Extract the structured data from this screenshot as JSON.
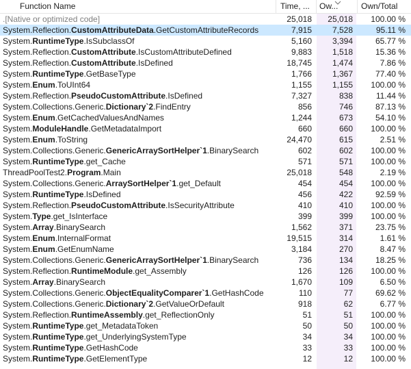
{
  "columns": {
    "name": "Function Name",
    "time": "Time, ...",
    "own": "Ow...",
    "pct": "Own/Total"
  },
  "rows": [
    {
      "parts": [
        {
          "t": ".[Native or optimized code]",
          "b": false
        }
      ],
      "time": "25,018",
      "own": "25,018",
      "pct": "100.00 %",
      "native": true
    },
    {
      "parts": [
        {
          "t": "System.Reflection.",
          "b": false
        },
        {
          "t": "CustomAttributeData",
          "b": true
        },
        {
          "t": ".GetCustomAttributeRecords",
          "b": false
        }
      ],
      "time": "7,915",
      "own": "7,528",
      "pct": "95.11 %",
      "selected": true
    },
    {
      "parts": [
        {
          "t": "System.",
          "b": false
        },
        {
          "t": "RuntimeType",
          "b": true
        },
        {
          "t": ".IsSubclassOf",
          "b": false
        }
      ],
      "time": "5,160",
      "own": "3,394",
      "pct": "65.77 %"
    },
    {
      "parts": [
        {
          "t": "System.Reflection.",
          "b": false
        },
        {
          "t": "CustomAttribute",
          "b": true
        },
        {
          "t": ".IsCustomAttributeDefined",
          "b": false
        }
      ],
      "time": "9,883",
      "own": "1,518",
      "pct": "15.36 %"
    },
    {
      "parts": [
        {
          "t": "System.Reflection.",
          "b": false
        },
        {
          "t": "CustomAttribute",
          "b": true
        },
        {
          "t": ".IsDefined",
          "b": false
        }
      ],
      "time": "18,745",
      "own": "1,474",
      "pct": "7.86 %"
    },
    {
      "parts": [
        {
          "t": "System.",
          "b": false
        },
        {
          "t": "RuntimeType",
          "b": true
        },
        {
          "t": ".GetBaseType",
          "b": false
        }
      ],
      "time": "1,766",
      "own": "1,367",
      "pct": "77.40 %"
    },
    {
      "parts": [
        {
          "t": "System.",
          "b": false
        },
        {
          "t": "Enum",
          "b": true
        },
        {
          "t": ".ToUInt64",
          "b": false
        }
      ],
      "time": "1,155",
      "own": "1,155",
      "pct": "100.00 %"
    },
    {
      "parts": [
        {
          "t": "System.Reflection.",
          "b": false
        },
        {
          "t": "PseudoCustomAttribute",
          "b": true
        },
        {
          "t": ".IsDefined",
          "b": false
        }
      ],
      "time": "7,327",
      "own": "838",
      "pct": "11.44 %"
    },
    {
      "parts": [
        {
          "t": "System.Collections.Generic.",
          "b": false
        },
        {
          "t": "Dictionary`2",
          "b": true
        },
        {
          "t": ".FindEntry",
          "b": false
        }
      ],
      "time": "856",
      "own": "746",
      "pct": "87.13 %"
    },
    {
      "parts": [
        {
          "t": "System.",
          "b": false
        },
        {
          "t": "Enum",
          "b": true
        },
        {
          "t": ".GetCachedValuesAndNames",
          "b": false
        }
      ],
      "time": "1,244",
      "own": "673",
      "pct": "54.10 %"
    },
    {
      "parts": [
        {
          "t": "System.",
          "b": false
        },
        {
          "t": "ModuleHandle",
          "b": true
        },
        {
          "t": ".GetMetadataImport",
          "b": false
        }
      ],
      "time": "660",
      "own": "660",
      "pct": "100.00 %"
    },
    {
      "parts": [
        {
          "t": "System.",
          "b": false
        },
        {
          "t": "Enum",
          "b": true
        },
        {
          "t": ".ToString",
          "b": false
        }
      ],
      "time": "24,470",
      "own": "615",
      "pct": "2.51 %"
    },
    {
      "parts": [
        {
          "t": "System.Collections.Generic.",
          "b": false
        },
        {
          "t": "GenericArraySortHelper`1",
          "b": true
        },
        {
          "t": ".BinarySearch",
          "b": false
        }
      ],
      "time": "602",
      "own": "602",
      "pct": "100.00 %"
    },
    {
      "parts": [
        {
          "t": "System.",
          "b": false
        },
        {
          "t": "RuntimeType",
          "b": true
        },
        {
          "t": ".get_Cache",
          "b": false
        }
      ],
      "time": "571",
      "own": "571",
      "pct": "100.00 %"
    },
    {
      "parts": [
        {
          "t": "ThreadPoolTest2.",
          "b": false
        },
        {
          "t": "Program",
          "b": true
        },
        {
          "t": ".Main",
          "b": false
        }
      ],
      "time": "25,018",
      "own": "548",
      "pct": "2.19 %"
    },
    {
      "parts": [
        {
          "t": "System.Collections.Generic.",
          "b": false
        },
        {
          "t": "ArraySortHelper`1",
          "b": true
        },
        {
          "t": ".get_Default",
          "b": false
        }
      ],
      "time": "454",
      "own": "454",
      "pct": "100.00 %"
    },
    {
      "parts": [
        {
          "t": "System.",
          "b": false
        },
        {
          "t": "RuntimeType",
          "b": true
        },
        {
          "t": ".IsDefined",
          "b": false
        }
      ],
      "time": "456",
      "own": "422",
      "pct": "92.59 %"
    },
    {
      "parts": [
        {
          "t": "System.Reflection.",
          "b": false
        },
        {
          "t": "PseudoCustomAttribute",
          "b": true
        },
        {
          "t": ".IsSecurityAttribute",
          "b": false
        }
      ],
      "time": "410",
      "own": "410",
      "pct": "100.00 %"
    },
    {
      "parts": [
        {
          "t": "System.",
          "b": false
        },
        {
          "t": "Type",
          "b": true
        },
        {
          "t": ".get_IsInterface",
          "b": false
        }
      ],
      "time": "399",
      "own": "399",
      "pct": "100.00 %"
    },
    {
      "parts": [
        {
          "t": "System.",
          "b": false
        },
        {
          "t": "Array",
          "b": true
        },
        {
          "t": ".BinarySearch",
          "b": false
        }
      ],
      "time": "1,562",
      "own": "371",
      "pct": "23.75 %"
    },
    {
      "parts": [
        {
          "t": "System.",
          "b": false
        },
        {
          "t": "Enum",
          "b": true
        },
        {
          "t": ".InternalFormat",
          "b": false
        }
      ],
      "time": "19,515",
      "own": "314",
      "pct": "1.61 %"
    },
    {
      "parts": [
        {
          "t": "System.",
          "b": false
        },
        {
          "t": "Enum",
          "b": true
        },
        {
          "t": ".GetEnumName",
          "b": false
        }
      ],
      "time": "3,184",
      "own": "270",
      "pct": "8.47 %"
    },
    {
      "parts": [
        {
          "t": "System.Collections.Generic.",
          "b": false
        },
        {
          "t": "GenericArraySortHelper`1",
          "b": true
        },
        {
          "t": ".BinarySearch",
          "b": false
        }
      ],
      "time": "736",
      "own": "134",
      "pct": "18.25 %"
    },
    {
      "parts": [
        {
          "t": "System.Reflection.",
          "b": false
        },
        {
          "t": "RuntimeModule",
          "b": true
        },
        {
          "t": ".get_Assembly",
          "b": false
        }
      ],
      "time": "126",
      "own": "126",
      "pct": "100.00 %"
    },
    {
      "parts": [
        {
          "t": "System.",
          "b": false
        },
        {
          "t": "Array",
          "b": true
        },
        {
          "t": ".BinarySearch",
          "b": false
        }
      ],
      "time": "1,670",
      "own": "109",
      "pct": "6.50 %"
    },
    {
      "parts": [
        {
          "t": "System.Collections.Generic.",
          "b": false
        },
        {
          "t": "ObjectEqualityComparer`1",
          "b": true
        },
        {
          "t": ".GetHashCode",
          "b": false
        }
      ],
      "time": "110",
      "own": "77",
      "pct": "69.62 %"
    },
    {
      "parts": [
        {
          "t": "System.Collections.Generic.",
          "b": false
        },
        {
          "t": "Dictionary`2",
          "b": true
        },
        {
          "t": ".GetValueOrDefault",
          "b": false
        }
      ],
      "time": "918",
      "own": "62",
      "pct": "6.77 %"
    },
    {
      "parts": [
        {
          "t": "System.Reflection.",
          "b": false
        },
        {
          "t": "RuntimeAssembly",
          "b": true
        },
        {
          "t": ".get_ReflectionOnly",
          "b": false
        }
      ],
      "time": "51",
      "own": "51",
      "pct": "100.00 %"
    },
    {
      "parts": [
        {
          "t": "System.",
          "b": false
        },
        {
          "t": "RuntimeType",
          "b": true
        },
        {
          "t": ".get_MetadataToken",
          "b": false
        }
      ],
      "time": "50",
      "own": "50",
      "pct": "100.00 %"
    },
    {
      "parts": [
        {
          "t": "System.",
          "b": false
        },
        {
          "t": "RuntimeType",
          "b": true
        },
        {
          "t": ".get_UnderlyingSystemType",
          "b": false
        }
      ],
      "time": "34",
      "own": "34",
      "pct": "100.00 %"
    },
    {
      "parts": [
        {
          "t": "System.",
          "b": false
        },
        {
          "t": "RuntimeType",
          "b": true
        },
        {
          "t": ".GetHashCode",
          "b": false
        }
      ],
      "time": "33",
      "own": "33",
      "pct": "100.00 %"
    },
    {
      "parts": [
        {
          "t": "System.",
          "b": false
        },
        {
          "t": "RuntimeType",
          "b": true
        },
        {
          "t": ".GetElementType",
          "b": false
        }
      ],
      "time": "12",
      "own": "12",
      "pct": "100.00 %"
    }
  ],
  "icons": {
    "sort": "sort-descending-icon"
  },
  "colors": {
    "selected_row": "#cce8ff",
    "sorted_column": "#f5eefa",
    "native_text": "#808080"
  }
}
